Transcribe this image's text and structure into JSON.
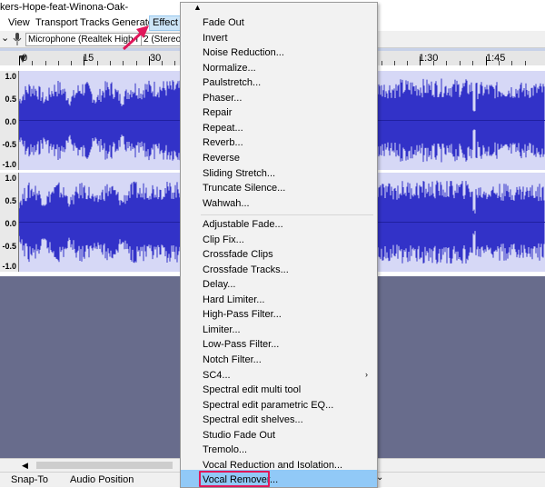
{
  "window": {
    "title": "kers-Hope-feat-Winona-Oak-"
  },
  "menubar": {
    "items": [
      {
        "label": "View"
      },
      {
        "label": "Transport"
      },
      {
        "label": "Tracks"
      },
      {
        "label": "Generate"
      },
      {
        "label": "Effect"
      }
    ]
  },
  "devicebar": {
    "input_device": "Microphone (Realtek High I",
    "channels": "2 (Stereo)"
  },
  "ruler": {
    "labels": [
      "0",
      "15",
      "30",
      "1:30",
      "1:45"
    ]
  },
  "tracks": {
    "scale_labels": [
      "1.0",
      "0.5",
      "0.0",
      "-0.5",
      "-1.0"
    ]
  },
  "statusbar": {
    "snap_to": "Snap-To",
    "audio_position": "Audio Position"
  },
  "effect_menu": {
    "group1": [
      "Fade Out",
      "Invert",
      "Noise Reduction...",
      "Normalize...",
      "Paulstretch...",
      "Phaser...",
      "Repair",
      "Repeat...",
      "Reverb...",
      "Reverse",
      "Sliding Stretch...",
      "Truncate Silence...",
      "Wahwah..."
    ],
    "group2": [
      "Adjustable Fade...",
      "Clip Fix...",
      "Crossfade Clips",
      "Crossfade Tracks...",
      "Delay...",
      "Hard Limiter...",
      "High-Pass Filter...",
      "Limiter...",
      "Low-Pass Filter...",
      "Notch Filter...",
      "SC4...",
      "Spectral edit multi tool",
      "Spectral edit parametric EQ...",
      "Spectral edit shelves...",
      "Studio Fade Out",
      "Tremolo...",
      "Vocal Reduction and Isolation...",
      "Vocal Remover..."
    ]
  },
  "colors": {
    "waveform": "#3232c8",
    "selection": "#8a8ee6",
    "highlight": "#91c9f7",
    "annotation": "#e0175a"
  }
}
